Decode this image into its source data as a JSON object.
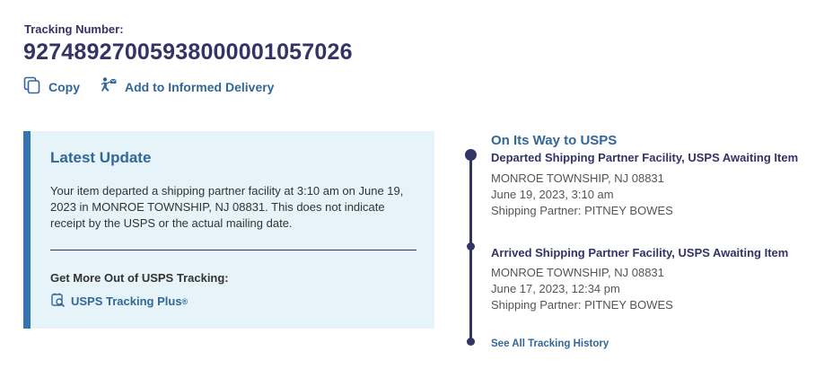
{
  "tracking": {
    "label": "Tracking Number:",
    "number": "9274892700593800000105702​6"
  },
  "actions": {
    "copy_label": "Copy",
    "informed_label": "Add to Informed Delivery"
  },
  "latest_update": {
    "title": "Latest Update",
    "text": "Your item departed a shipping partner facility at 3:10 am on June 19, 2023 in MONROE TOWNSHIP, NJ 08831. This does not indicate receipt by the USPS or the actual mailing date.",
    "more_title": "Get More Out of USPS Tracking:",
    "plus_link": "USPS Tracking Plus",
    "plus_mark": "®"
  },
  "timeline": {
    "status": "On Its Way to USPS",
    "events": [
      {
        "title": "Departed Shipping Partner Facility, USPS Awaiting Item",
        "location": "MONROE TOWNSHIP, NJ 08831",
        "datetime": "June 19, 2023, 3:10 am",
        "partner": "Shipping Partner: PITNEY BOWES"
      },
      {
        "title": "Arrived Shipping Partner Facility, USPS Awaiting Item",
        "location": "MONROE TOWNSHIP, NJ 08831",
        "datetime": "June 17, 2023, 12:34 pm",
        "partner": "Shipping Partner: PITNEY BOWES"
      }
    ],
    "history_link": "See All Tracking History"
  },
  "icons": {
    "copy": "copy-icon",
    "informed": "delivery-person-icon",
    "plus": "tracking-plus-icon"
  },
  "colors": {
    "navy": "#333366",
    "link_blue": "#336699",
    "panel_bg": "#e6f4f9",
    "panel_accent": "#3573b1"
  }
}
